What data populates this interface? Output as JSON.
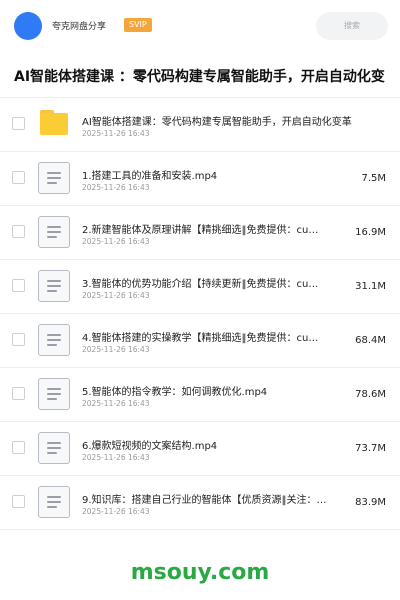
{
  "header": {
    "share_name": "夸克网盘分享",
    "badge": "SVIP",
    "search_placeholder": "搜索"
  },
  "title": "AI智能体搭建课 ：零代码构建专属智能助手，开启自动化变",
  "files": [
    {
      "type": "folder",
      "name": "AI智能体搭建课：零代码构建专属智能助手，开启自动化变革",
      "date": "2025-11-26 16:43",
      "size": ""
    },
    {
      "type": "file",
      "name": "1.搭建工具的准备和安装.mp4",
      "date": "2025-11-26 16:43",
      "size": "7.5M"
    },
    {
      "type": "file",
      "name": "2.新建智能体及原理讲解【精挑细选‖免费提供：cu…",
      "date": "2025-11-26 16:43",
      "size": "16.9M"
    },
    {
      "type": "file",
      "name": "3.智能体的优势功能介绍【持续更新‖免费提供：cu…",
      "date": "2025-11-26 16:43",
      "size": "31.1M"
    },
    {
      "type": "file",
      "name": "4.智能体搭建的实操教学【精挑细选‖免费提供：cu…",
      "date": "2025-11-26 16:43",
      "size": "68.4M"
    },
    {
      "type": "file",
      "name": "5.智能体的指令教学：如何调教优化.mp4",
      "date": "2025-11-26 16:43",
      "size": "78.6M"
    },
    {
      "type": "file",
      "name": "6.爆款短视频的文案结构.mp4",
      "date": "2025-11-26 16:43",
      "size": "73.7M"
    },
    {
      "type": "file",
      "name": "9.知识库：搭建自己行业的智能体【优质资源‖关注：…",
      "date": "2025-11-26 16:43",
      "size": "83.9M"
    }
  ],
  "watermark": "msouy.com"
}
